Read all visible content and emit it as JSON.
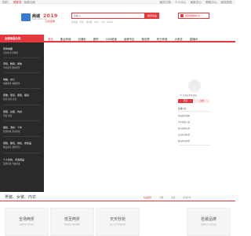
{
  "topbar": {
    "greeting": "您好，",
    "login": "请登录",
    "register": "免费注册",
    "right_links": [
      "我的订单",
      "个人中心",
      "商家中心",
      "帮助中心",
      "网站导航"
    ]
  },
  "logo": {
    "brand": "商城",
    "tagline": "www.shop.com"
  },
  "promo": {
    "number": "2019",
    "label": "狂欢盛典"
  },
  "search": {
    "placeholder": "请输入...",
    "button": "搜索商品",
    "hot_words": [
      "连衣裙",
      "手机",
      "运动鞋",
      "Shirt",
      "Top",
      "Shoes"
    ]
  },
  "cart": {
    "label": "我的购物车(0)"
  },
  "nav": {
    "category_label": "全部商品分类",
    "items": [
      "首页",
      "集运商城",
      "店铺街",
      "团购",
      "CMS频道",
      "品牌专区",
      "聚划算",
      "积分商城",
      "大家说",
      "直播间"
    ]
  },
  "categories": [
    {
      "title": "家用电器",
      "sub": "大家电 生活电器"
    },
    {
      "title": "手机、数码、通信",
      "sub": "手机通讯 数码配件"
    },
    {
      "title": "电脑、办公",
      "sub": "电脑整机 电脑配件"
    },
    {
      "title": "家居、家具、家装、厨具",
      "sub": "厨具 家纺 家具"
    },
    {
      "title": "男装、女装、内衣",
      "sub": "男装 女装"
    },
    {
      "title": "美妆、洗护、个护",
      "sub": "面部护肤 香水彩妆"
    },
    {
      "title": "鞋靴、箱包、钟表、奢侈品",
      "sub": "精品女包 潮流男包"
    },
    {
      "title": "个人化妆、清洁用品",
      "sub": "面部护肤 洗发护发"
    }
  ],
  "user_panel": {
    "hi": "Hi, 欢迎来到本商城",
    "login_button": "登录",
    "register_button": "注册",
    "news_title": "商城公告",
    "news_items": [
      "系统维护通知",
      "关于新版上线",
      "春节放假安排",
      "会员权益升级",
      "配送时效说明"
    ]
  },
  "section": {
    "title": "男装、女装、内衣",
    "tabs": [
      "热品推荐",
      "男装",
      "女装",
      "运动户外"
    ],
    "active_tab": 0
  },
  "products": [
    {
      "title": "全场两折",
      "sub": "品牌男装 低至2折"
    },
    {
      "title": "低至两折",
      "sub": "精选女装 限时抢购"
    },
    {
      "title": "天天秒抢",
      "sub": "每日上新 超值优惠"
    },
    {
      "title": "名媛品牌",
      "sub": "优雅时尚 品质之选"
    }
  ],
  "colors": {
    "accent": "#e4393c",
    "category_bg": "#2a2a2a"
  }
}
